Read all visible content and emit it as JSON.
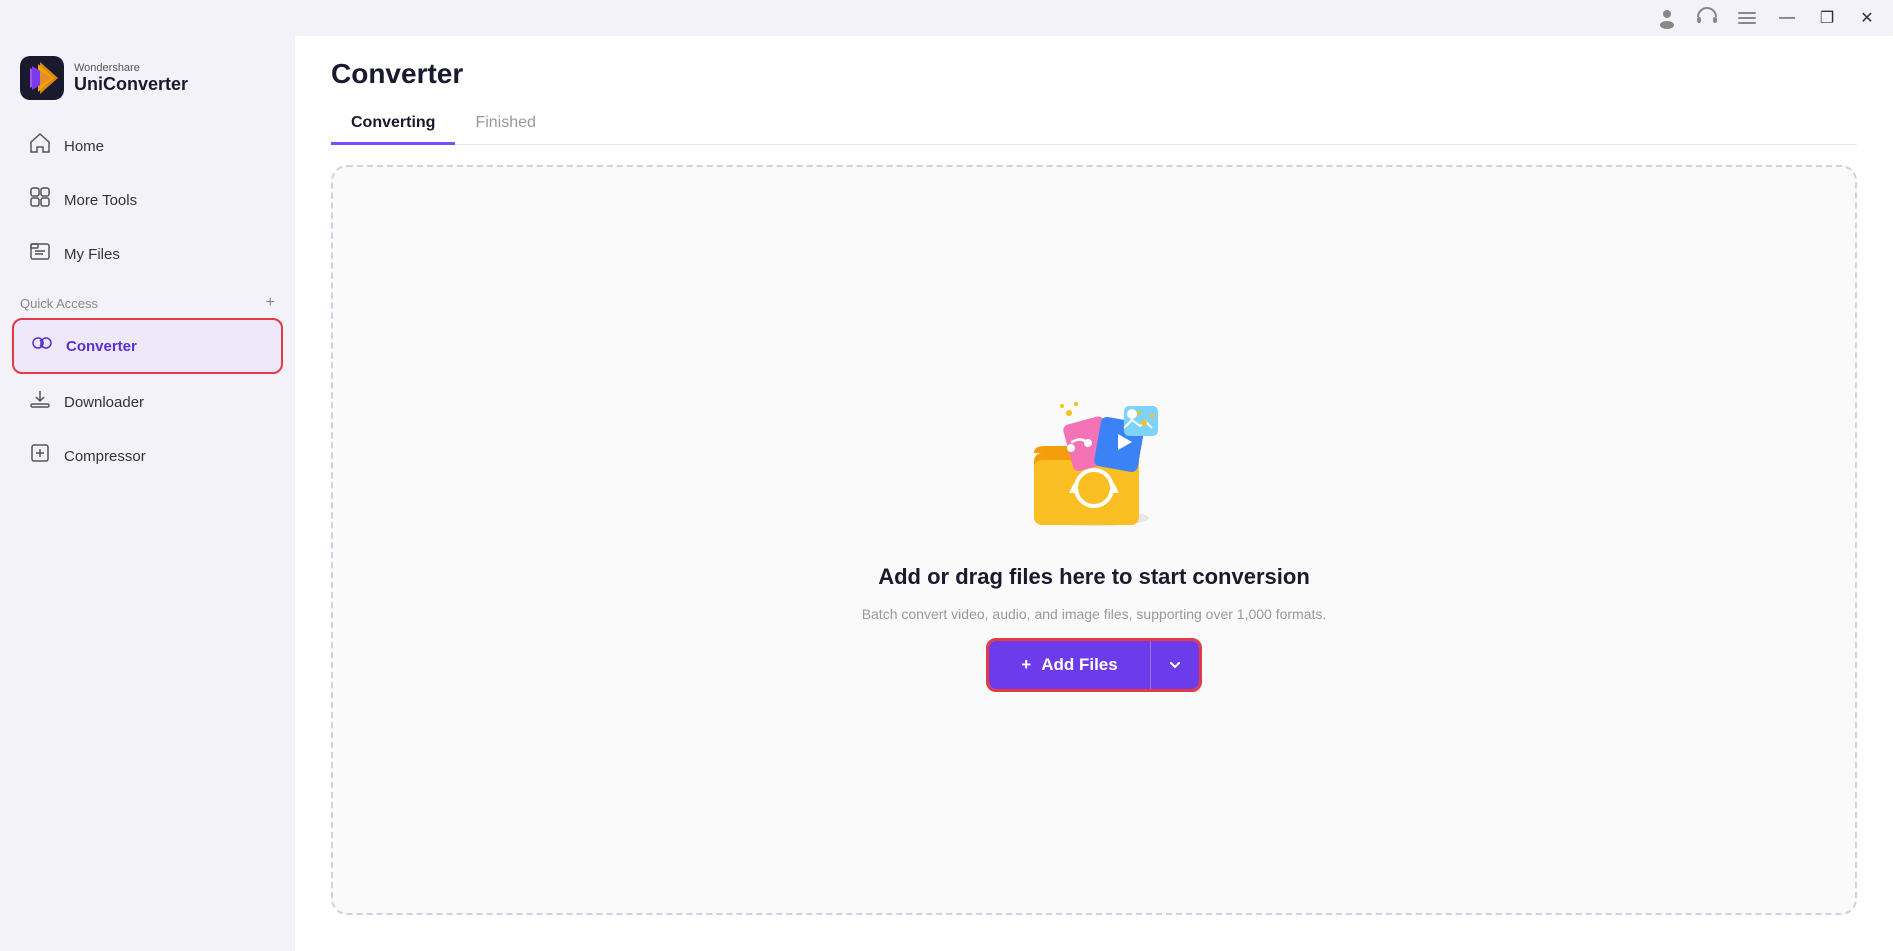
{
  "titlebar": {
    "buttons": {
      "minimize": "—",
      "maximize": "❐",
      "close": "✕"
    }
  },
  "sidebar": {
    "logo": {
      "top": "Wondershare",
      "bottom": "UniConverter"
    },
    "nav_items": [
      {
        "id": "home",
        "label": "Home",
        "icon": "🏠"
      },
      {
        "id": "more-tools",
        "label": "More Tools",
        "icon": "⊟"
      },
      {
        "id": "my-files",
        "label": "My Files",
        "icon": "⊟"
      }
    ],
    "quick_access_label": "Quick Access",
    "quick_access_plus": "+",
    "quick_access_items": [
      {
        "id": "converter",
        "label": "Converter",
        "icon": "🔄",
        "active": true
      },
      {
        "id": "downloader",
        "label": "Downloader",
        "icon": "⬇"
      },
      {
        "id": "compressor",
        "label": "Compressor",
        "icon": "🗜"
      }
    ]
  },
  "main": {
    "title": "Converter",
    "tabs": [
      {
        "id": "converting",
        "label": "Converting",
        "active": true
      },
      {
        "id": "finished",
        "label": "Finished",
        "active": false
      }
    ],
    "drop_area": {
      "title": "Add or drag files here to start conversion",
      "subtitle": "Batch convert video, audio, and image files, supporting over 1,000 formats."
    },
    "add_files_button": {
      "label": "Add Files",
      "plus": "+"
    }
  }
}
